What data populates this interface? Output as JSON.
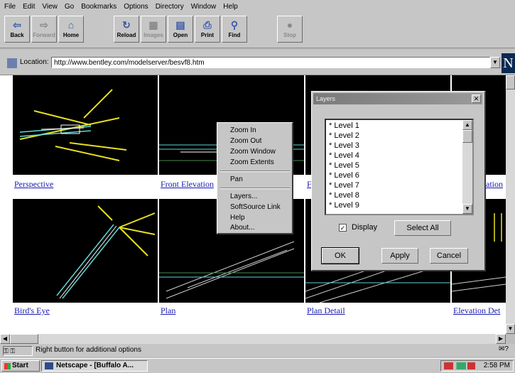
{
  "menubar": [
    "File",
    "Edit",
    "View",
    "Go",
    "Bookmarks",
    "Options",
    "Directory",
    "Window",
    "Help"
  ],
  "toolbar": {
    "back": "Back",
    "forward": "Forward",
    "home": "Home",
    "reload": "Reload",
    "images": "Images",
    "open": "Open",
    "print": "Print",
    "find": "Find",
    "stop": "Stop"
  },
  "location": {
    "label": "Location:",
    "url": "http://www.bentley.com/modelserver/besvf8.htm",
    "logo": "N"
  },
  "views": [
    {
      "caption": "Perspective"
    },
    {
      "caption": "Front Elevation"
    },
    {
      "caption": "F"
    },
    {
      "caption": "ration"
    },
    {
      "caption": "Bird's Eye"
    },
    {
      "caption": "Plan"
    },
    {
      "caption": "Plan Detail"
    },
    {
      "caption": "Elevation Det"
    }
  ],
  "context_menu": {
    "items": [
      "Zoom In",
      "Zoom Out",
      "Zoom Window",
      "Zoom Extents",
      "Pan",
      "Layers...",
      "SoftSource Link",
      "Help",
      "About..."
    ]
  },
  "layers_dialog": {
    "title": "Layers",
    "levels": [
      "* Level 1",
      "* Level 2",
      "* Level 3",
      "* Level 4",
      "* Level 5",
      "* Level 6",
      "* Level 7",
      "* Level 8",
      "* Level 9"
    ],
    "display_label": "Display",
    "display_checked": true,
    "select_all": "Select All",
    "ok": "OK",
    "apply": "Apply",
    "cancel": "Cancel"
  },
  "status": {
    "text": "Right button for additional options"
  },
  "taskbar": {
    "start": "Start",
    "item": "Netscape - [Buffalo A...",
    "time": "2:58 PM"
  }
}
